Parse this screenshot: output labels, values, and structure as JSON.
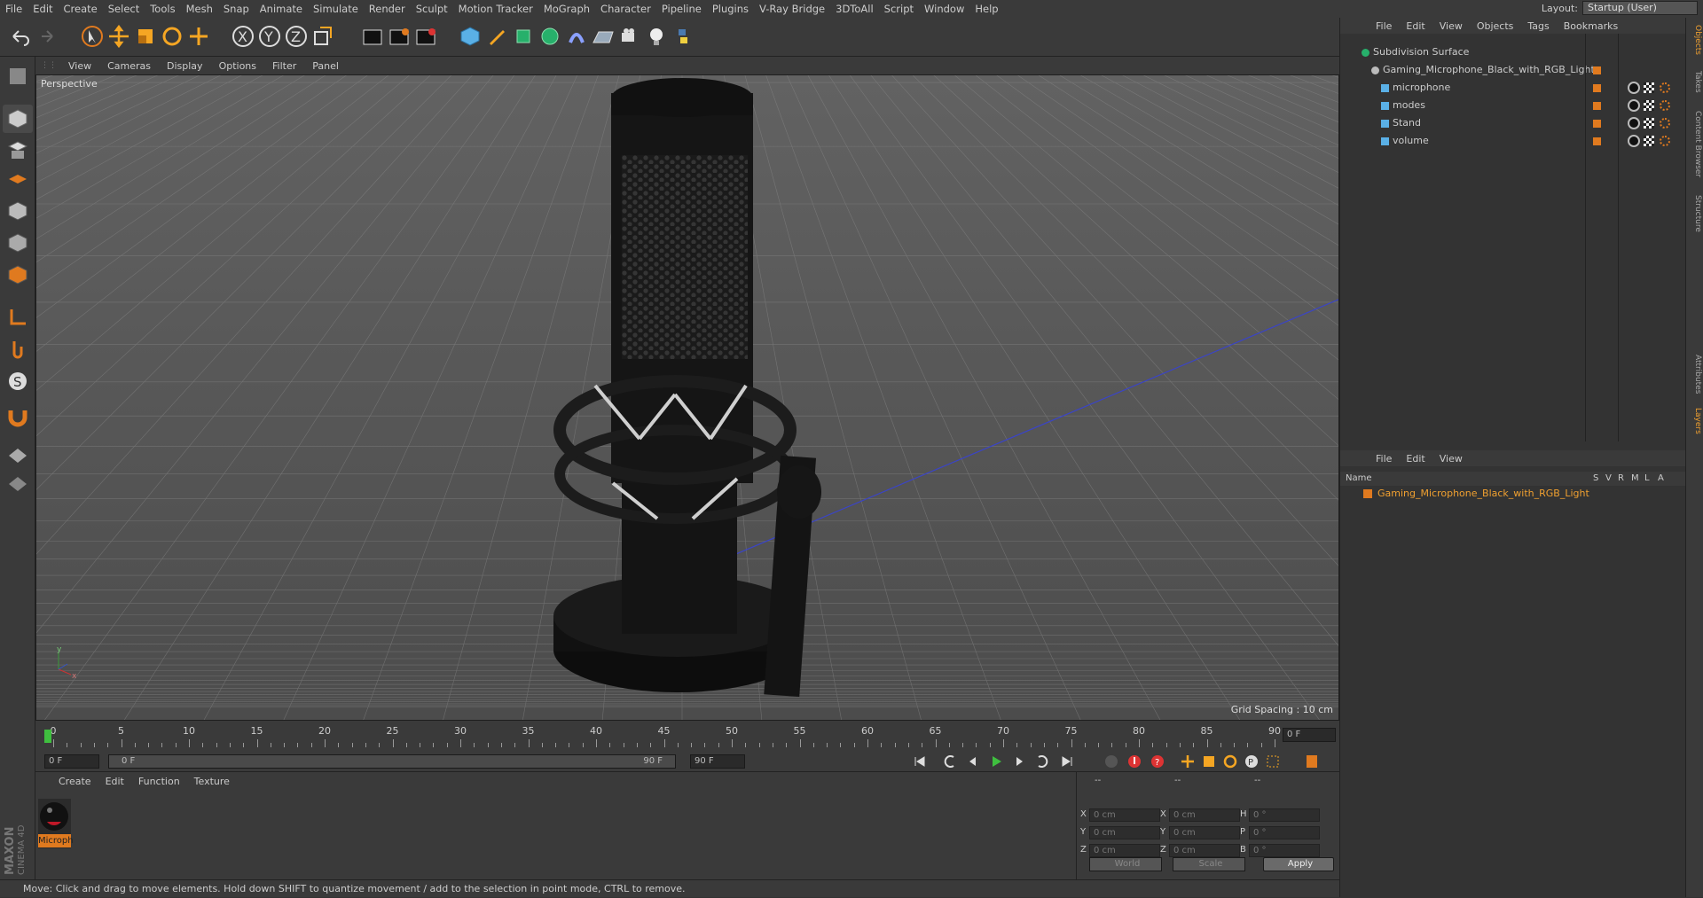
{
  "menubar": {
    "items": [
      "File",
      "Edit",
      "Create",
      "Select",
      "Tools",
      "Mesh",
      "Snap",
      "Animate",
      "Simulate",
      "Render",
      "Sculpt",
      "Motion Tracker",
      "MoGraph",
      "Character",
      "Pipeline",
      "Plugins",
      "V-Ray Bridge",
      "3DToAll",
      "Script",
      "Window",
      "Help"
    ],
    "layout_label": "Layout:",
    "layout_value": "Startup (User)"
  },
  "toolbar": {
    "icons": [
      "undo-icon",
      "redo-icon",
      "select-arrow-icon",
      "move-icon",
      "scale-icon",
      "rotate-icon",
      "add-object-icon",
      "x-axis-icon",
      "y-axis-icon",
      "z-axis-icon",
      "coordinate-system-icon",
      "render-view-icon",
      "render-picture-viewer-icon",
      "render-settings-icon",
      "cube-icon",
      "pen-icon",
      "subdivision-icon",
      "mograph-icon",
      "deformer-icon",
      "floor-icon",
      "camera-icon",
      "light-icon",
      "python-icon"
    ]
  },
  "left_tools": [
    "make-editable-icon",
    "model-mode-icon",
    "texture-mode-icon",
    "workplane-icon",
    "point-mode-icon",
    "edge-mode-icon",
    "polygon-mode-icon",
    "axis-mode-icon",
    "tweak-icon",
    "solo-icon",
    "snap-magnet-icon",
    "workplane-lock-icon",
    "sculpt-grid-icon"
  ],
  "viewport": {
    "menu": [
      "View",
      "Cameras",
      "Display",
      "Options",
      "Filter",
      "Panel"
    ],
    "label": "Perspective",
    "grid_spacing": "Grid Spacing : 10 cm"
  },
  "timeline": {
    "ticks": [
      "0",
      "5",
      "10",
      "15",
      "20",
      "25",
      "30",
      "35",
      "40",
      "45",
      "50",
      "55",
      "60",
      "65",
      "70",
      "75",
      "80",
      "85",
      "90"
    ],
    "current_frame": "0 F"
  },
  "playbar": {
    "start_field": "0 F",
    "range_start": "0 F",
    "range_end": "90 F",
    "end_field": "90 F"
  },
  "material_manager": {
    "menu": [
      "Create",
      "Edit",
      "Function",
      "Texture"
    ],
    "material_label": "Microph"
  },
  "coords": {
    "rows": [
      {
        "a": "X",
        "av": "0 cm",
        "b": "X",
        "bv": "0 cm",
        "c": "H",
        "cv": "0 °"
      },
      {
        "a": "Y",
        "av": "0 cm",
        "b": "Y",
        "bv": "0 cm",
        "c": "P",
        "cv": "0 °"
      },
      {
        "a": "Z",
        "av": "0 cm",
        "b": "Z",
        "bv": "0 cm",
        "c": "B",
        "cv": "0 °"
      }
    ],
    "header": [
      "--",
      "--",
      "--"
    ],
    "world": "World",
    "scale": "Scale",
    "apply": "Apply"
  },
  "object_manager": {
    "menu": [
      "File",
      "Edit",
      "View",
      "Objects",
      "Tags",
      "Bookmarks"
    ],
    "items": [
      {
        "name": "Subdivision Surface",
        "indent": 0
      },
      {
        "name": "Gaming_Microphone_Black_with_RGB_Light",
        "indent": 1
      },
      {
        "name": "microphone",
        "indent": 2
      },
      {
        "name": "modes",
        "indent": 2
      },
      {
        "name": "Stand",
        "indent": 2
      },
      {
        "name": "volume",
        "indent": 2
      }
    ]
  },
  "layer_manager": {
    "menu": [
      "File",
      "Edit",
      "View"
    ],
    "columns": [
      "Name",
      "S",
      "V",
      "R",
      "M",
      "L",
      "A"
    ],
    "layer_name": "Gaming_Microphone_Black_with_RGB_Light"
  },
  "right_tabs": [
    "Objects",
    "Takes",
    "Content Browser",
    "Structure",
    "Attributes",
    "Layers"
  ],
  "status": "Move: Click and drag to move elements. Hold down SHIFT to quantize movement / add to the selection in point mode, CTRL to remove.",
  "brand": {
    "line1": "MAXON",
    "line2": "CINEMA 4D"
  },
  "colors": {
    "accent": "#e07a1f",
    "selection": "#f0a030",
    "bg_panel": "#3a3a3a"
  }
}
